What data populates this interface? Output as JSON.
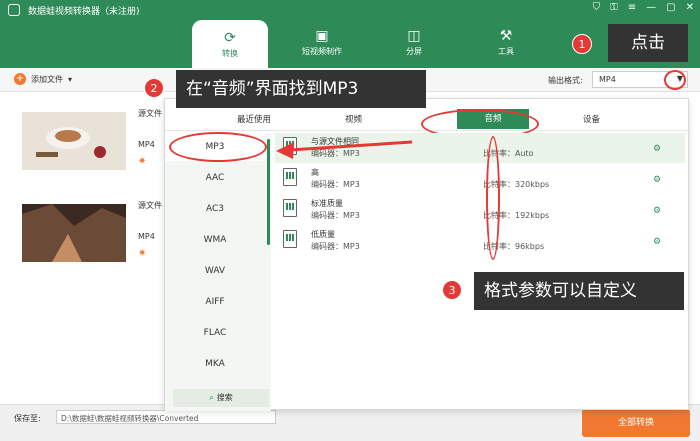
{
  "app": {
    "title": "数据蛙视频转换器（未注册)"
  },
  "window_controls": [
    "⛉",
    "⚿",
    "≡",
    "—",
    "▢",
    "✕"
  ],
  "nav": [
    {
      "label": "转换",
      "icon": "convert-icon",
      "glyph": "⟳",
      "active": true
    },
    {
      "label": "短视频制作",
      "icon": "clapper-icon",
      "glyph": "🎬",
      "active": false
    },
    {
      "label": "分屏",
      "icon": "split-screen-icon",
      "glyph": "◫",
      "active": false
    },
    {
      "label": "工具",
      "icon": "toolbox-icon",
      "glyph": "⚒",
      "active": false
    }
  ],
  "toolbar": {
    "add_file": "添加文件",
    "output_label": "输出格式:",
    "output_value": "MP4"
  },
  "files": [
    {
      "name": "源文件",
      "format": "MP4"
    },
    {
      "name": "源文件",
      "format": "MP4"
    }
  ],
  "bottom": {
    "save_label": "保存至:",
    "save_path": "D:\\数据蛙\\数据蛙视频转换器\\Converted",
    "convert_button": "全部转换"
  },
  "popup": {
    "tabs": [
      "最近使用",
      "视频",
      "音频",
      "设备"
    ],
    "active_tab": "音频",
    "formats": [
      "MP3",
      "AAC",
      "AC3",
      "WMA",
      "WAV",
      "AIFF",
      "FLAC",
      "MKA"
    ],
    "selected_format": "MP3",
    "search_label": "搜索",
    "presets": [
      {
        "name": "与源文件相同",
        "encoder": "编码器：MP3",
        "bitrate": "比特率：Auto"
      },
      {
        "name": "高",
        "encoder": "编码器：MP3",
        "bitrate": "比特率：320kbps"
      },
      {
        "name": "标准质量",
        "encoder": "编码器：MP3",
        "bitrate": "比特率：192kbps"
      },
      {
        "name": "低质量",
        "encoder": "编码器：MP3",
        "bitrate": "比特率：96kbps"
      }
    ]
  },
  "annotations": {
    "step1_num": "1",
    "step1_text": "点击",
    "step2_num": "2",
    "step2_text": "在“音频”界面找到MP3",
    "step3_num": "3",
    "step3_text": "格式参数可以自定义"
  },
  "colors": {
    "brand_green": "#2e8b57",
    "accent_orange": "#f07830",
    "annotation_red": "#e53935"
  }
}
